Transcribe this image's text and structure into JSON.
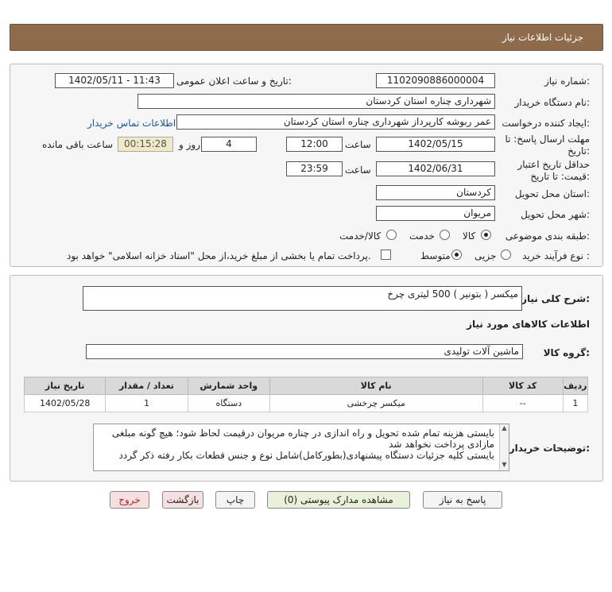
{
  "header": {
    "title": "جزئیات اطلاعات نیاز"
  },
  "need_number": {
    "label": "شماره نیاز:",
    "value": "1102090886000004"
  },
  "announce": {
    "label": "تاریخ و ساعت اعلان عمومی:",
    "value": "1402/05/11 - 11:43"
  },
  "buyer_org": {
    "label": "نام دستگاه خریدار:",
    "value": "شهرداری چناره استان کردستان"
  },
  "requester": {
    "label": "ایجاد کننده درخواست:",
    "value": "عمر ربوشه کارپرداز  شهرداری چناره استان کردستان",
    "contact_link": "اطلاعات تماس خریدار"
  },
  "reply_deadline": {
    "label_line1": "مهلت ارسال پاسخ: تا",
    "label_line2": "تاریخ:",
    "date": "1402/05/15",
    "time_label": "ساعت",
    "time": "12:00",
    "days": "4",
    "days_label": "روز و",
    "remaining": "00:15:28",
    "remaining_label": "ساعت باقی مانده"
  },
  "price_validity": {
    "label_line1": "حداقل تاریخ اعتبار",
    "label_line2": "قیمت: تا تاریخ:",
    "date": "1402/06/31",
    "time_label": "ساعت",
    "time": "23:59"
  },
  "delivery_province": {
    "label": "استان محل تحویل:",
    "value": "کردستان"
  },
  "delivery_city": {
    "label": "شهر محل تحویل:",
    "value": "مریوان"
  },
  "category": {
    "label": "طبقه بندی موضوعی:",
    "options": [
      "کالا",
      "خدمت",
      "کالا/خدمت"
    ],
    "selected": "کالا"
  },
  "purchase_process": {
    "label": "نوع فرآیند خرید :",
    "options": [
      "جزیی",
      "متوسط"
    ],
    "selected": "متوسط",
    "treasury_note": "پرداخت تمام یا بخشی از مبلغ خرید،از محل \"اسناد خزانه اسلامی\" خواهد بود."
  },
  "general_desc": {
    "label": "شرح کلی نیاز:",
    "value": "میکسر ( بتونیر ) 500 لیتری چرخ"
  },
  "goods_info_title": "اطلاعات کالاهای مورد نیاز",
  "goods_group": {
    "label": "گروه کالا:",
    "value": "ماشین آلات تولیدی"
  },
  "table": {
    "headers": [
      "ردیف",
      "کد کالا",
      "نام کالا",
      "واحد شمارش",
      "تعداد / مقدار",
      "تاریخ نیاز"
    ],
    "rows": [
      [
        "1",
        "--",
        "میکسر چرخشی",
        "دستگاه",
        "1",
        "1402/05/28"
      ]
    ]
  },
  "buyer_notes": {
    "label": "توضیحات خریدار:",
    "lines": [
      "بایستی هزینه تمام شده تحویل و راه اندازی در چناره مریوان درقیمت لحاظ شود؛ هیچ گونه مبلغی مازادی پرداخت نخواهد شد",
      "بایستی کلیه جزئیات دستگاه پیشنهادی(بطورکامل)شامل نوع و جنس قطعات بکار رفته ذکر گردد"
    ]
  },
  "buttons": {
    "reply": "پاسخ به نیاز",
    "view_docs": "مشاهده مدارک پیوستی (0)",
    "print": "چاپ",
    "back": "بازگشت",
    "exit": "خروج"
  }
}
